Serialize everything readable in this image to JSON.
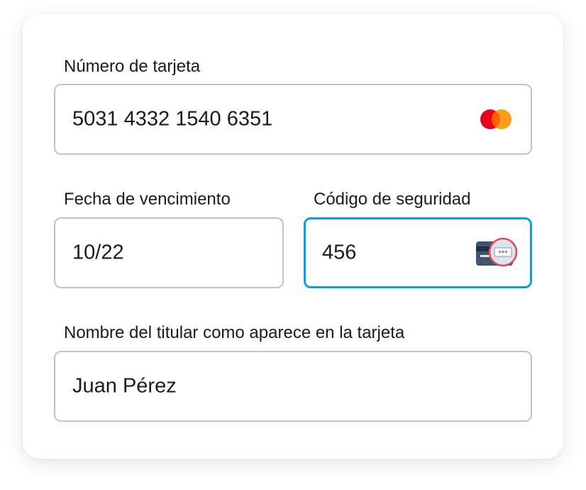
{
  "form": {
    "card_number": {
      "label": "Número de tarjeta",
      "value": "5031 4332 1540 6351",
      "brand_icon": "mastercard-icon"
    },
    "expiry": {
      "label": "Fecha de vencimiento",
      "value": "10/22"
    },
    "security_code": {
      "label": "Código de seguridad",
      "value": "456",
      "hint_icon": "card-cvv-icon",
      "hint_text": "***"
    },
    "holder_name": {
      "label": "Nombre del titular como aparece en la tarjeta",
      "value": "Juan Pérez"
    }
  },
  "colors": {
    "focus_border": "#0aa0dd",
    "field_border": "#c3c3c3",
    "mastercard_red": "#eb001b",
    "mastercard_orange": "#f79e1b",
    "highlight_ring": "#e5484d"
  }
}
